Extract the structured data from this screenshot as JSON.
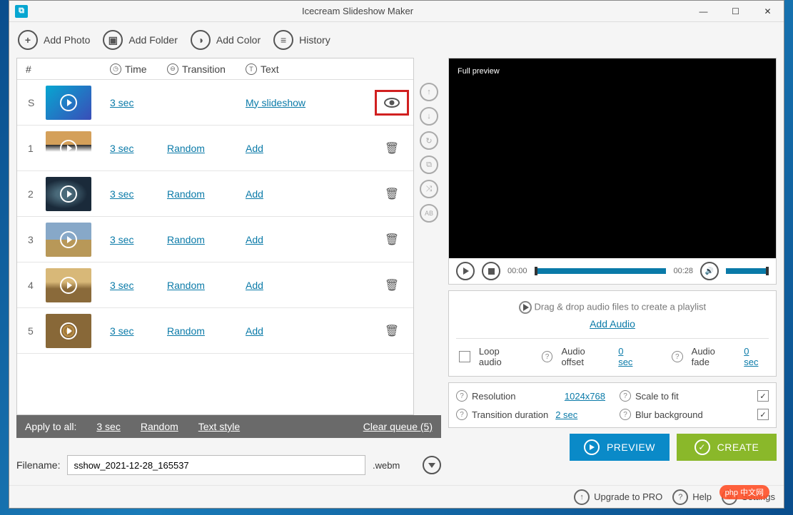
{
  "app": {
    "title": "Icecream Slideshow Maker"
  },
  "toolbar": {
    "add_photo": "Add Photo",
    "add_folder": "Add Folder",
    "add_color": "Add Color",
    "history": "History"
  },
  "table": {
    "headers": {
      "num": "#",
      "time": "Time",
      "transition": "Transition",
      "text": "Text"
    },
    "rows": [
      {
        "idx": "S",
        "time": "3 sec",
        "transition": "",
        "text": "My slideshow",
        "action": "eye"
      },
      {
        "idx": "1",
        "time": "3 sec",
        "transition": "Random",
        "text": "Add",
        "action": "trash"
      },
      {
        "idx": "2",
        "time": "3 sec",
        "transition": "Random",
        "text": "Add",
        "action": "trash"
      },
      {
        "idx": "3",
        "time": "3 sec",
        "transition": "Random",
        "text": "Add",
        "action": "trash"
      },
      {
        "idx": "4",
        "time": "3 sec",
        "transition": "Random",
        "text": "Add",
        "action": "trash"
      },
      {
        "idx": "5",
        "time": "3 sec",
        "transition": "Random",
        "text": "Add",
        "action": "trash"
      }
    ]
  },
  "apply_to_all": {
    "label": "Apply to all:",
    "time": "3 sec",
    "transition": "Random",
    "text_style": "Text style",
    "clear_queue": "Clear queue (5)"
  },
  "filename": {
    "label": "Filename:",
    "value": "sshow_2021-12-28_165537",
    "ext": ".webm"
  },
  "preview": {
    "full_preview": "Full preview",
    "time_start": "00:00",
    "time_end": "00:28"
  },
  "audio": {
    "drop_hint": "Drag & drop audio files to create a playlist",
    "add_audio": "Add Audio",
    "loop_audio": "Loop audio",
    "offset_label": "Audio offset",
    "offset_value": "0 sec",
    "fade_label": "Audio fade",
    "fade_value": "0 sec"
  },
  "settings": {
    "resolution_label": "Resolution",
    "resolution_value": "1024x768",
    "scale_label": "Scale to fit",
    "duration_label": "Transition duration",
    "duration_value": "2 sec",
    "blur_label": "Blur background"
  },
  "buttons": {
    "preview": "PREVIEW",
    "create": "CREATE"
  },
  "footer": {
    "upgrade": "Upgrade to PRO",
    "help": "Help",
    "settings": "Settings",
    "watermark": "php 中文网"
  }
}
